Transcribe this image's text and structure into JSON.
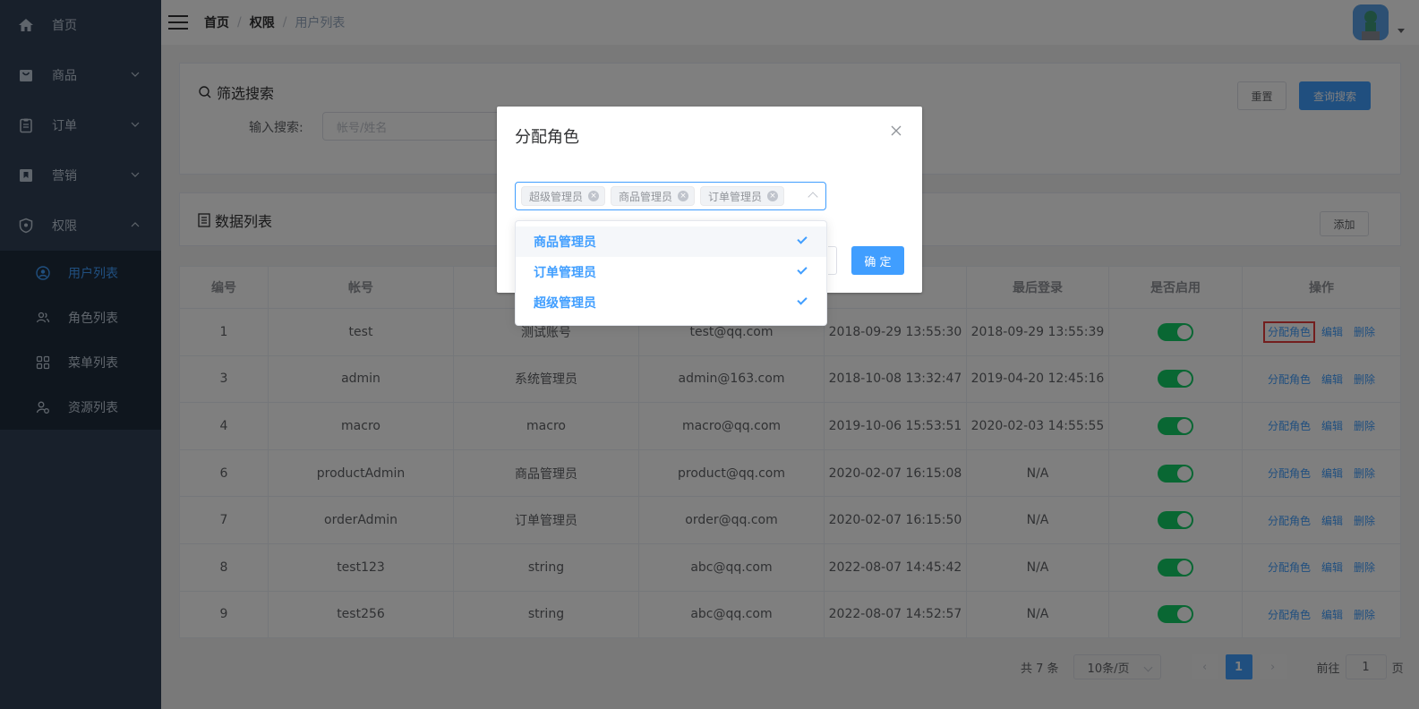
{
  "colors": {
    "accent": "#409eff",
    "sidebar_bg": "#304156",
    "highlight": "#e63c3c"
  },
  "sidebar": {
    "items": [
      {
        "label": "首页",
        "icon": "home-icon"
      },
      {
        "label": "商品",
        "icon": "shopping-bag-icon"
      },
      {
        "label": "订单",
        "icon": "clipboard-icon"
      },
      {
        "label": "营销",
        "icon": "bookmark-icon"
      },
      {
        "label": "权限",
        "icon": "shield-icon"
      }
    ],
    "submenu": [
      {
        "label": "用户列表",
        "icon": "user-circle-icon",
        "active": true
      },
      {
        "label": "角色列表",
        "icon": "users-icon"
      },
      {
        "label": "菜单列表",
        "icon": "grid-icon"
      },
      {
        "label": "资源列表",
        "icon": "user-settings-icon"
      }
    ]
  },
  "breadcrumb": [
    "首页",
    "权限",
    "用户列表"
  ],
  "filter": {
    "title": "筛选搜索",
    "reset_label": "重置",
    "search_label": "查询搜索",
    "input_label": "输入搜索:",
    "input_placeholder": "帐号/姓名"
  },
  "list": {
    "title": "数据列表",
    "add_label": "添加"
  },
  "table": {
    "headers": [
      "编号",
      "帐号",
      "",
      "",
      "",
      "最后登录",
      "是否启用",
      "操作"
    ],
    "rows": [
      {
        "id": "1",
        "account": "test",
        "name": "测试账号",
        "email": "test@qq.com",
        "created": "2018-09-29 13:55:30",
        "last_login": "2018-09-29 13:55:39",
        "enabled": true
      },
      {
        "id": "3",
        "account": "admin",
        "name": "系统管理员",
        "email": "admin@163.com",
        "created": "2018-10-08 13:32:47",
        "last_login": "2019-04-20 12:45:16",
        "enabled": true
      },
      {
        "id": "4",
        "account": "macro",
        "name": "macro",
        "email": "macro@qq.com",
        "created": "2019-10-06 15:53:51",
        "last_login": "2020-02-03 14:55:55",
        "enabled": true
      },
      {
        "id": "6",
        "account": "productAdmin",
        "name": "商品管理员",
        "email": "product@qq.com",
        "created": "2020-02-07 16:15:08",
        "last_login": "N/A",
        "enabled": true
      },
      {
        "id": "7",
        "account": "orderAdmin",
        "name": "订单管理员",
        "email": "order@qq.com",
        "created": "2020-02-07 16:15:50",
        "last_login": "N/A",
        "enabled": true
      },
      {
        "id": "8",
        "account": "test123",
        "name": "string",
        "email": "abc@qq.com",
        "created": "2022-08-07 14:45:42",
        "last_login": "N/A",
        "enabled": true
      },
      {
        "id": "9",
        "account": "test256",
        "name": "string",
        "email": "abc@qq.com",
        "created": "2022-08-07 14:52:57",
        "last_login": "N/A",
        "enabled": true
      }
    ],
    "ops": {
      "assign": "分配角色",
      "edit": "编辑",
      "delete": "删除"
    }
  },
  "pagination": {
    "total": "共 7 条",
    "page_size": "10条/页",
    "current": "1",
    "goto_prefix": "前往",
    "goto_value": "1",
    "goto_suffix": "页"
  },
  "dialog": {
    "title": "分配角色",
    "selected_tags": [
      "超级管理员",
      "商品管理员",
      "订单管理员"
    ],
    "options": [
      "商品管理员",
      "订单管理员",
      "超级管理员"
    ],
    "confirm_label": "确 定"
  }
}
